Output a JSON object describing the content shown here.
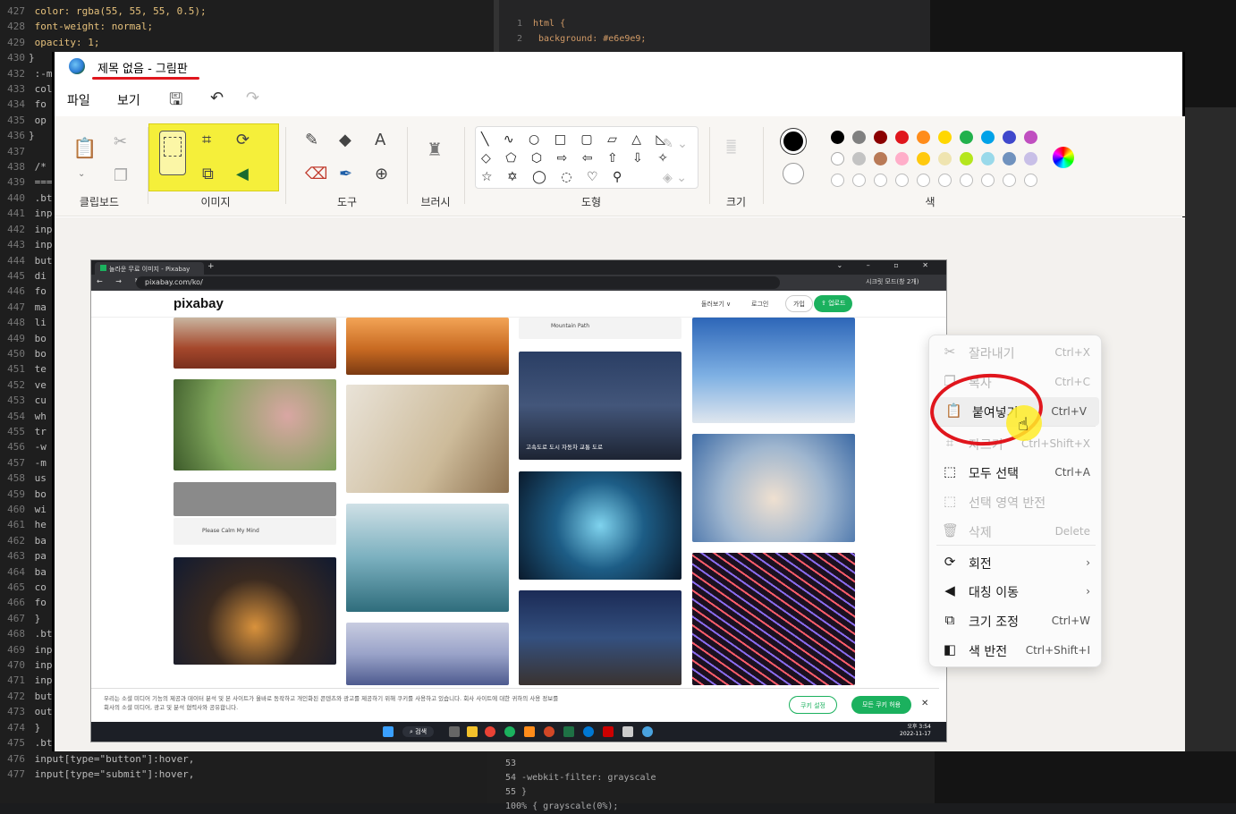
{
  "window": {
    "title": "제목 없음 - 그림판"
  },
  "menu": {
    "file": "파일",
    "view": "보기"
  },
  "ribbon": {
    "groups": {
      "clipboard": "클립보드",
      "image": "이미지",
      "tools": "도구",
      "brushes": "브러시",
      "shapes": "도형",
      "size": "크기",
      "colors": "색"
    },
    "tool_glyphs": {
      "pencil": "✎",
      "fill": "◆",
      "text": "A",
      "eraser": "⌫",
      "picker": "✒",
      "magnifier": "⊕",
      "brush": "♜"
    },
    "shape_rows": [
      "╲ ∿ ○ □ ▢ ▱ △ ◺",
      "◇ ⬠ ⬡ ⇨ ⇦ ⇧ ⇩ ✧",
      "☆ ✡ ◯ ◌ ♡ ⚲"
    ],
    "palette": [
      "#000000",
      "#808080",
      "#8b0000",
      "#e0161d",
      "#ff8c1a",
      "#ffd700",
      "#22b14c",
      "#00a2e8",
      "#3f48cc",
      "#c04fc0",
      "#ffffff",
      "#c3c3c3",
      "#b97a57",
      "#ffaec9",
      "#ffc90e",
      "#efe4b0",
      "#b5e61d",
      "#99d9ea",
      "#7092be",
      "#c8bfe7"
    ]
  },
  "browser": {
    "tab_title": "놀라운 무료 이미지 - Pixabay",
    "url": "pixabay.com/ko/",
    "profile": "시크릿 모드(창 2개)"
  },
  "pixabay": {
    "logo": "pixabay",
    "explore": "둘러보기 ∨",
    "login": "로그인",
    "join": "가입",
    "upload": "⇪ 업로드",
    "audio_title": "Please Calm My Mind",
    "mountain_title": "Mountain Path",
    "road_caption": "고속도로 도시 자동차 교통 도로",
    "cookie_text": "우리는 소셜 미디어 기능의 제공과 데이터 분석 및 본 사이트가 올바로 동작하고 개인화된 콘텐츠와 광고를 제공하기 위해 쿠키를 사용하고 있습니다. 회사 사이트에 대한 귀하의 사용 정보를 회사의 소셜 미디어, 광고 및 분석 협력사와 공유합니다.",
    "cookie_settings": "쿠키 설정",
    "cookie_accept": "모든 쿠키 허용"
  },
  "taskbar": {
    "search": "검색",
    "time": "오후 3:54",
    "date": "2022-11-17"
  },
  "context_menu": {
    "items": [
      {
        "label": "잘라내기",
        "shortcut": "Ctrl+X",
        "enabled": false,
        "icon": "scissors-icon"
      },
      {
        "label": "복사",
        "shortcut": "Ctrl+C",
        "enabled": false,
        "icon": "copy-icon"
      },
      {
        "label": "붙여넣기",
        "shortcut": "Ctrl+V",
        "enabled": true,
        "icon": "paste-icon"
      },
      {
        "label": "자르기",
        "shortcut": "Ctrl+Shift+X",
        "enabled": false,
        "icon": "crop-icon"
      },
      {
        "label": "모두 선택",
        "shortcut": "Ctrl+A",
        "enabled": true,
        "icon": "select-all-icon"
      },
      {
        "label": "선택 영역 반전",
        "shortcut": "",
        "enabled": false,
        "icon": "invert-selection-icon"
      },
      {
        "label": "삭제",
        "shortcut": "Delete",
        "enabled": false,
        "icon": "trash-icon"
      },
      {
        "label": "회전",
        "shortcut": "›",
        "enabled": true,
        "icon": "rotate-icon"
      },
      {
        "label": "대칭 이동",
        "shortcut": "›",
        "enabled": true,
        "icon": "flip-icon"
      },
      {
        "label": "크기 조정",
        "shortcut": "Ctrl+W",
        "enabled": true,
        "icon": "resize-icon"
      },
      {
        "label": "색 반전",
        "shortcut": "Ctrl+Shift+I",
        "enabled": true,
        "icon": "invert-color-icon"
      }
    ]
  },
  "background_code": {
    "left_lines": [
      [
        "427",
        "  color: rgba(55, 55, 55, 0.5);"
      ],
      [
        "428",
        "  font-weight: normal;"
      ],
      [
        "429",
        "  opacity: 1;"
      ],
      [
        "430",
        "}"
      ],
      [
        "432",
        "  :-ms-"
      ],
      [
        "433",
        "  col"
      ],
      [
        "434",
        "  fo"
      ],
      [
        "435",
        "  op"
      ],
      [
        "436",
        "}"
      ],
      [
        "437",
        ""
      ],
      [
        "438",
        "  /* B"
      ],
      [
        "439",
        "  ====="
      ],
      [
        "440",
        "  .btn,"
      ],
      [
        "441",
        "  input"
      ],
      [
        "442",
        "  input"
      ],
      [
        "443",
        "  input"
      ],
      [
        "444",
        "  butt"
      ],
      [
        "445",
        "    di"
      ],
      [
        "446",
        "    fo"
      ],
      [
        "447",
        "    ma"
      ],
      [
        "448",
        "    li"
      ],
      [
        "449",
        "    bo"
      ],
      [
        "450",
        "    bo"
      ],
      [
        "451",
        "    te"
      ],
      [
        "452",
        "    ve"
      ],
      [
        "453",
        "    cu"
      ],
      [
        "454",
        "    wh"
      ],
      [
        "455",
        "    tr"
      ],
      [
        "456",
        "    -w"
      ],
      [
        "457",
        "    -m"
      ],
      [
        "458",
        "    us"
      ],
      [
        "459",
        "    bo"
      ],
      [
        "460",
        "    wi"
      ],
      [
        "461",
        "    he"
      ],
      [
        "462",
        "    ba"
      ],
      [
        "463",
        "    pa"
      ],
      [
        "464",
        "    ba"
      ],
      [
        "465",
        "    co"
      ],
      [
        "466",
        "    fo"
      ],
      [
        "467",
        "  }"
      ],
      [
        "468",
        "  .btn:"
      ],
      [
        "469",
        "  input"
      ],
      [
        "470",
        "  input"
      ],
      [
        "471",
        "  input"
      ],
      [
        "472",
        "  butto"
      ],
      [
        "473",
        "    out"
      ],
      [
        "474",
        "  }"
      ],
      [
        "475",
        "  .btn:hover, .comment"
      ],
      [
        "476",
        "  input[type=\"button\"]:hover,"
      ],
      [
        "477",
        "  input[type=\"submit\"]:hover,"
      ]
    ],
    "mid_lines": [
      [
        "1",
        "html {"
      ],
      [
        "2",
        "  background: #e6e9e9;"
      ]
    ],
    "bottom_lines": [
      [
        "53",
        ""
      ],
      [
        "54",
        "  -webkit-filter: grayscale"
      ],
      [
        "55",
        "}"
      ],
      [
        "",
        "  100% { grayscale(0%);"
      ]
    ]
  }
}
